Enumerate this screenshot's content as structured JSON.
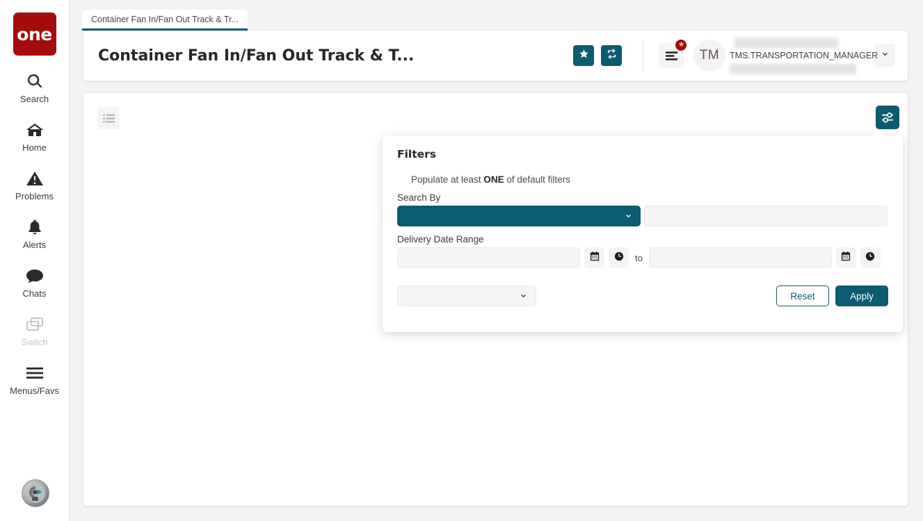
{
  "brand": {
    "logo_text": "one"
  },
  "theme": {
    "accent_teal": "#0b5c6e",
    "brand_red": "#a50d0d",
    "badge_red": "#9e0b14",
    "page_bg": "#f2f2f2",
    "field_bg": "#f4f4f4"
  },
  "sidebar": {
    "items": [
      {
        "label": "Search",
        "icon": "search-icon",
        "disabled": false
      },
      {
        "label": "Home",
        "icon": "home-icon",
        "disabled": false
      },
      {
        "label": "Problems",
        "icon": "warning-icon",
        "disabled": false
      },
      {
        "label": "Alerts",
        "icon": "bell-icon",
        "disabled": false
      },
      {
        "label": "Chats",
        "icon": "chat-icon",
        "disabled": false
      },
      {
        "label": "Switch",
        "icon": "switch-icon",
        "disabled": true
      },
      {
        "label": "Menus/Favs",
        "icon": "hamburger-icon",
        "disabled": false
      }
    ],
    "avatar_icon": "user-avatar-icon"
  },
  "tabs": [
    {
      "label": "Container Fan In/Fan Out Track & Tr...",
      "active": true
    }
  ],
  "header": {
    "title": "Container Fan In/Fan Out Track & T...",
    "favorite_icon": "star-icon",
    "refresh_icon": "refresh-icon",
    "menu_icon": "list-menu-icon",
    "menu_badge_icon": "star-icon",
    "avatar_initials": "TM",
    "username": "TMS.TRANSPORTATION_MANAGER",
    "user_caret_icon": "chevron-down-icon"
  },
  "content": {
    "list_view_icon": "list-view-icon",
    "filter_toggle_icon": "filter-sliders-icon"
  },
  "filters": {
    "title": "Filters",
    "hint_prefix": "Populate at least ",
    "hint_bold": "ONE",
    "hint_suffix": " of default filters",
    "search_by": {
      "label": "Search By",
      "select_value": "",
      "select_icon": "chevron-down-icon",
      "input_value": "",
      "input_placeholder": ""
    },
    "delivery_date_range": {
      "label": "Delivery Date Range",
      "from_value": "",
      "from_placeholder": "",
      "to_value": "",
      "to_placeholder": "",
      "separator_label": "to",
      "calendar_icon": "calendar-icon",
      "clock_icon": "clock-icon"
    },
    "footer_select": {
      "value": "",
      "icon": "chevron-down-icon"
    },
    "reset_label": "Reset",
    "apply_label": "Apply"
  }
}
